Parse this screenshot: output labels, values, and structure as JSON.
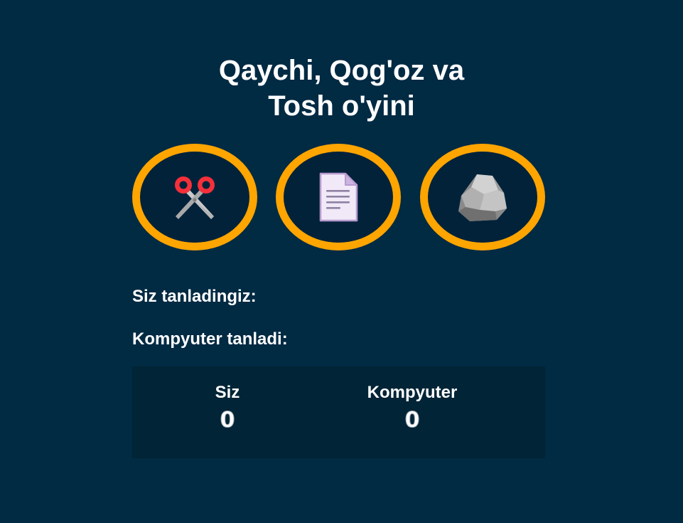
{
  "game": {
    "title_line1": "Qaychi, Qog'oz va",
    "title_line2": "Tosh o'yini",
    "choices": [
      {
        "name": "scissors",
        "icon": "scissors-icon"
      },
      {
        "name": "paper",
        "icon": "paper-document-icon"
      },
      {
        "name": "rock",
        "icon": "rock-icon"
      }
    ],
    "player_choice_label": "Siz tanladingiz:",
    "computer_choice_label": "Kompyuter tanladi:"
  },
  "score": {
    "player_label": "Siz",
    "player_value": "0",
    "computer_label": "Kompyuter",
    "computer_value": "0"
  },
  "colors": {
    "background": "#012a43",
    "score_background": "#012436",
    "ring": "#ffa500",
    "text": "#ffffff"
  }
}
